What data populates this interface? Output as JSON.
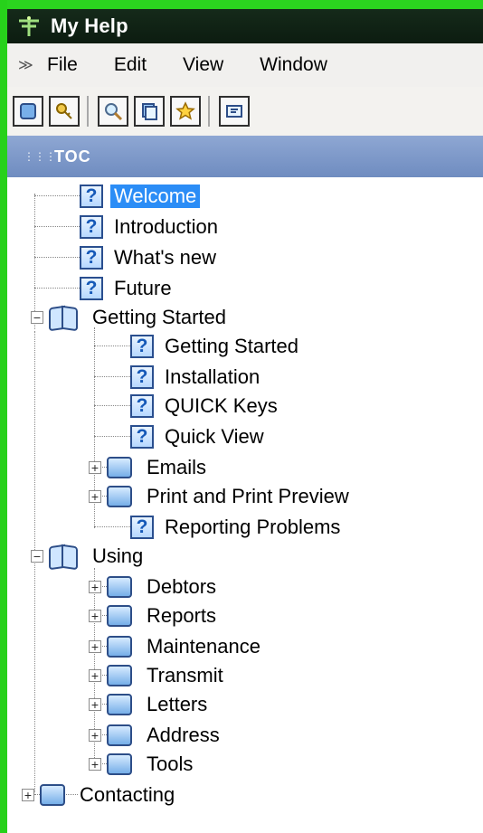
{
  "window": {
    "title": "My Help"
  },
  "menu": {
    "items": [
      "File",
      "Edit",
      "View",
      "Window"
    ]
  },
  "toc": {
    "title": "TOC"
  },
  "tree": {
    "items": [
      {
        "label": "Welcome",
        "icon": "help-topic-icon",
        "selected": true
      },
      {
        "label": "Introduction",
        "icon": "help-topic-icon"
      },
      {
        "label": "What's new",
        "icon": "help-topic-icon"
      },
      {
        "label": "Future",
        "icon": "help-topic-icon"
      },
      {
        "label": "Getting Started",
        "icon": "open-book-icon",
        "expanded": true
      },
      {
        "label": "Getting Started",
        "icon": "help-topic-icon"
      },
      {
        "label": "Installation",
        "icon": "help-topic-icon"
      },
      {
        "label": "QUICK Keys",
        "icon": "help-topic-icon"
      },
      {
        "label": "Quick View",
        "icon": "help-topic-icon"
      },
      {
        "label": "Emails",
        "icon": "book-icon",
        "expanded": false
      },
      {
        "label": "Print and Print Preview",
        "icon": "book-icon",
        "expanded": false
      },
      {
        "label": "Reporting Problems",
        "icon": "help-topic-icon"
      },
      {
        "label": "Using",
        "icon": "open-book-icon",
        "expanded": true
      },
      {
        "label": "Debtors",
        "icon": "book-icon",
        "expanded": false
      },
      {
        "label": "Reports",
        "icon": "book-icon",
        "expanded": false
      },
      {
        "label": "Maintenance",
        "icon": "book-icon",
        "expanded": false
      },
      {
        "label": "Transmit",
        "icon": "book-icon",
        "expanded": false
      },
      {
        "label": "Letters",
        "icon": "book-icon",
        "expanded": false
      },
      {
        "label": "Address",
        "icon": "book-icon",
        "expanded": false
      },
      {
        "label": "Tools",
        "icon": "book-icon",
        "expanded": false
      },
      {
        "label": "Contacting",
        "icon": "book-icon",
        "expanded": false
      }
    ]
  },
  "colors": {
    "border_green": "#2bd41f",
    "selection_blue": "#2b8df6",
    "toc_header": "#7f99c9"
  }
}
